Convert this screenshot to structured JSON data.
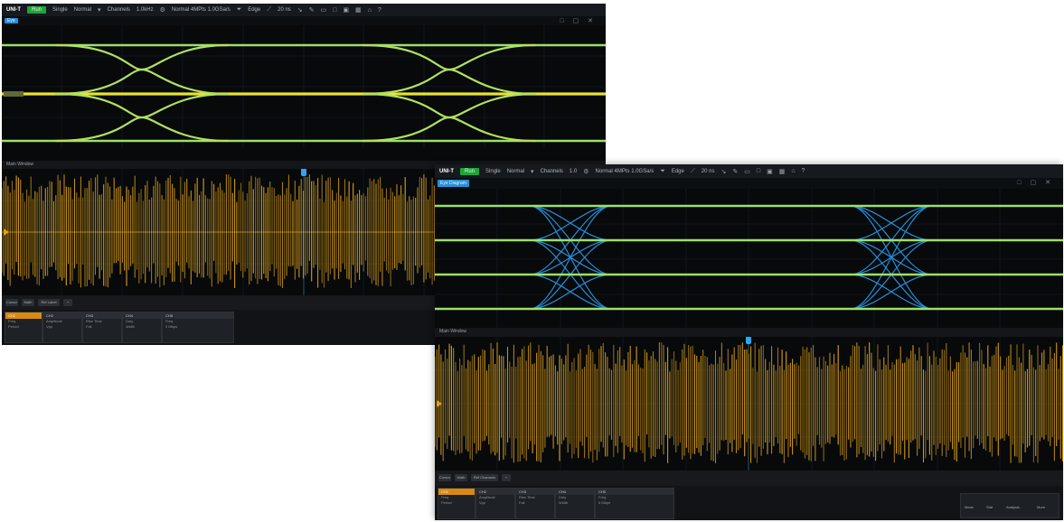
{
  "screenshots": [
    {
      "toolbar": {
        "logo": "UNI-T",
        "run_state": "Run",
        "mode": "Single",
        "acquire": "Normal",
        "menu_1": "Channels",
        "menu_2": "1.0kHz",
        "trigger": "Normal 4MPts 1.0GSa/s",
        "edge": "Edge",
        "time": "20 ns"
      },
      "eye_badge": "Eye",
      "zoom_header": "Main Window",
      "control_tabs": [
        "Cursor",
        "Math",
        "Ref Label"
      ],
      "measurements": [
        {
          "header": "CH1",
          "rows": [
            "Freq",
            "Period"
          ]
        },
        {
          "header": "CH2",
          "rows": [
            "Amplitude",
            "Vpp"
          ]
        },
        {
          "header": "CH3",
          "rows": [
            "Rise Time",
            "Fall"
          ]
        },
        {
          "header": "CH4",
          "rows": [
            "Duty",
            "Width"
          ]
        },
        {
          "header": "CH5",
          "rows": [
            "Freq",
            "0 Mbps"
          ]
        }
      ]
    },
    {
      "toolbar": {
        "logo": "UNI-T",
        "run_state": "Run",
        "mode": "Single",
        "acquire": "Normal",
        "menu_1": "Channels",
        "menu_2": "1.0",
        "trigger": "Normal 4MPts 1.0GSa/s",
        "edge": "Edge",
        "time": "20 ns"
      },
      "eye_badge": "Eye Diagram",
      "zoom_header": "Main Window",
      "control_tabs": [
        "Cursor",
        "Math",
        "Ref Channels"
      ],
      "measurements": [
        {
          "header": "CH1",
          "rows": [
            "Freq",
            "Period"
          ]
        },
        {
          "header": "CH2",
          "rows": [
            "Amplitude",
            "Vpp"
          ]
        },
        {
          "header": "CH3",
          "rows": [
            "Rise Time",
            "Fall"
          ]
        },
        {
          "header": "CH4",
          "rows": [
            "Duty",
            "Width"
          ]
        },
        {
          "header": "CH5",
          "rows": [
            "Freq",
            "0 Mbps"
          ]
        }
      ],
      "side_panel": [
        "Meas",
        "Stat",
        "Analysis",
        "More"
      ]
    }
  ],
  "colors": {
    "eye_green": "#9be06a",
    "eye_yellow": "#e6e23a",
    "eye_blue": "#2aa8ff",
    "wave_yellow": "#e0a315",
    "bg": "#07090b"
  }
}
